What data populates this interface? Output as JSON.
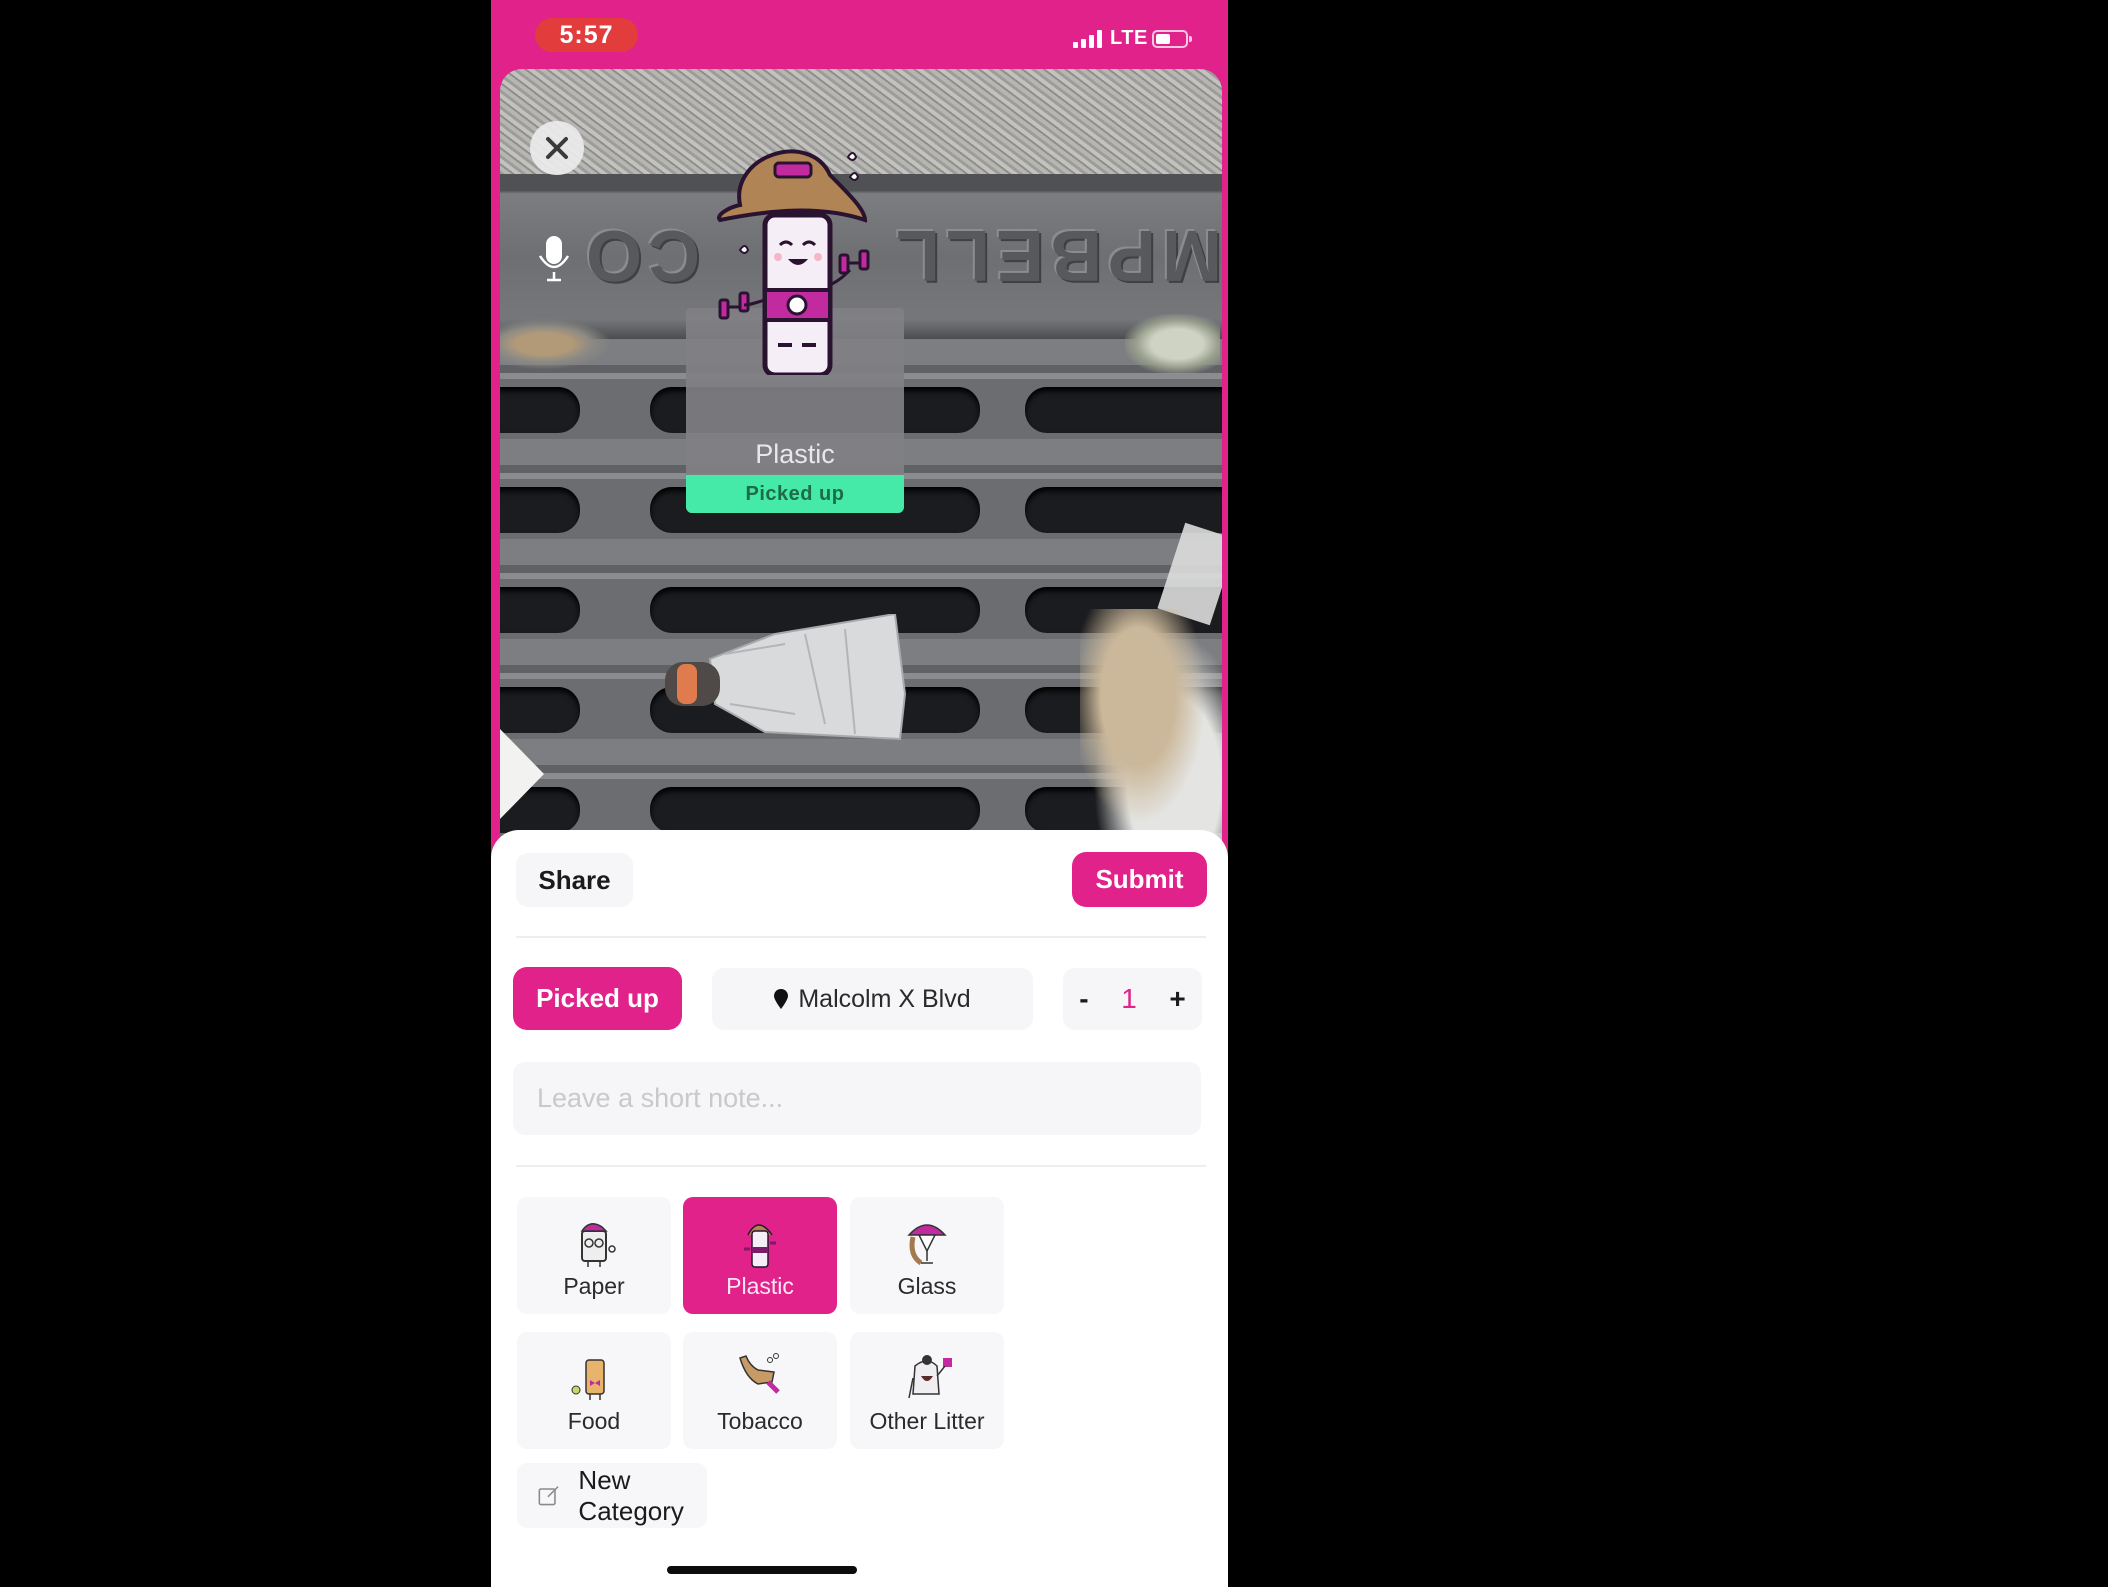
{
  "status_bar": {
    "time": "5:57",
    "network": "LTE",
    "signal_bars": 4,
    "battery_percent": 40
  },
  "photo": {
    "close_icon": "close-icon",
    "mic_icon": "microphone-icon",
    "grate_text_left": "CO",
    "grate_text_right": "AMPBELL",
    "marker": {
      "category": "Plastic",
      "location": "Malcolm X Blvd",
      "status": "Picked up"
    }
  },
  "sheet": {
    "share_label": "Share",
    "submit_label": "Submit",
    "status_label": "Picked up",
    "location_icon": "map-pin-icon",
    "location_label": "Malcolm X Blvd",
    "quantity": {
      "minus": "-",
      "value": "1",
      "plus": "+"
    },
    "note": {
      "value": "",
      "placeholder": "Leave a short note..."
    },
    "categories": [
      {
        "label": "Paper",
        "icon": "paper-mascot-icon",
        "selected": false
      },
      {
        "label": "Plastic",
        "icon": "plastic-bottle-mascot-icon",
        "selected": true
      },
      {
        "label": "Glass",
        "icon": "glass-mascot-icon",
        "selected": false
      },
      {
        "label": "Food",
        "icon": "food-mascot-icon",
        "selected": false
      },
      {
        "label": "Tobacco",
        "icon": "tobacco-pipe-mascot-icon",
        "selected": false
      },
      {
        "label": "Other Litter",
        "icon": "other-litter-mascot-icon",
        "selected": false
      }
    ],
    "new_category_label": "New Category",
    "new_category_icon": "edit-icon"
  },
  "colors": {
    "accent": "#e0228a",
    "status_green": "#45eaa8",
    "time_pill": "#e23c3c"
  }
}
